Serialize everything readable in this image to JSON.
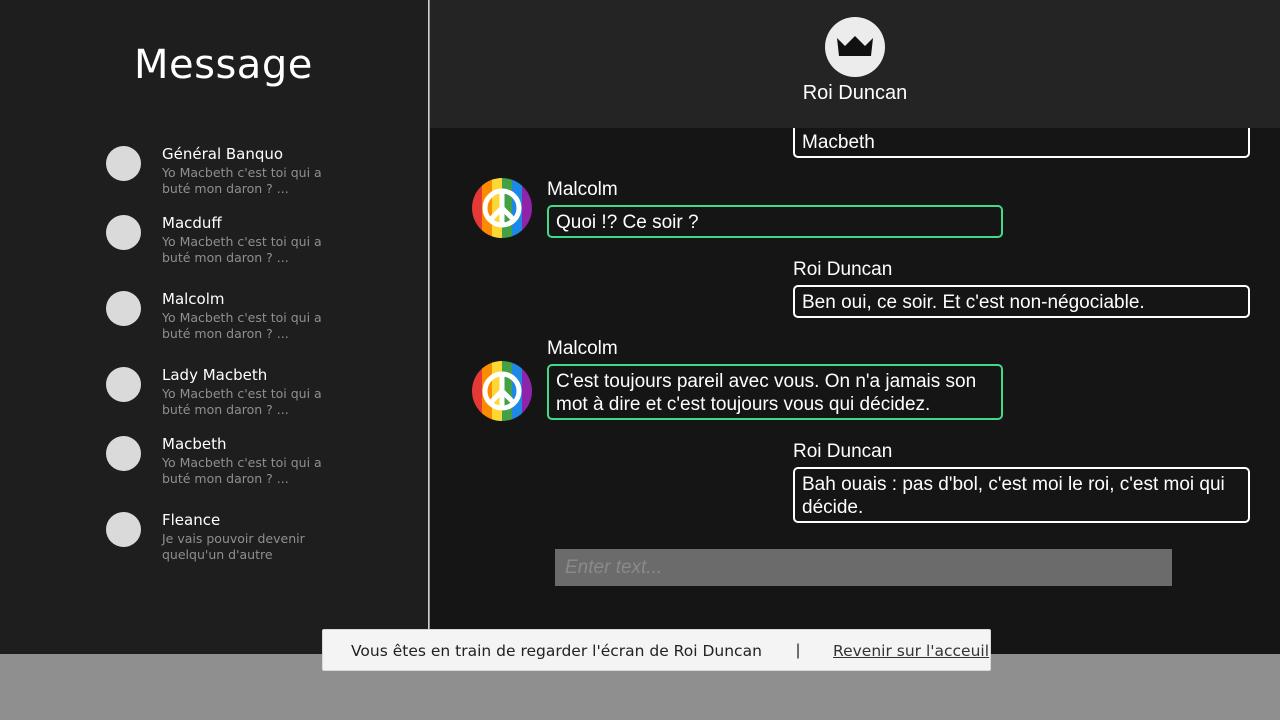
{
  "sidebar": {
    "title": "Message",
    "contacts": [
      {
        "name": "Général Banquo",
        "preview": "Yo Macbeth c'est toi qui a buté mon daron ? ..."
      },
      {
        "name": "Macduff",
        "preview": "Yo Macbeth c'est toi qui a buté mon daron ? ..."
      },
      {
        "name": "Malcolm",
        "preview": "Yo Macbeth c'est toi qui a buté mon daron ? ..."
      },
      {
        "name": "Lady Macbeth",
        "preview": "Yo Macbeth c'est toi qui a buté mon daron ? ..."
      },
      {
        "name": "Macbeth",
        "preview": "Yo Macbeth c'est toi qui a buté mon daron ? ..."
      },
      {
        "name": "Fleance",
        "preview": "Je vais pouvoir devenir quelqu'un d'autre"
      }
    ]
  },
  "header": {
    "name": "Roi Duncan",
    "avatar_icon": "crown-icon"
  },
  "chat": {
    "messages": [
      {
        "sender": "",
        "text": "Macbeth",
        "direction": "out"
      },
      {
        "sender": "Malcolm",
        "text": "Quoi !? Ce soir ?",
        "direction": "in",
        "avatar_icon": "peace-rainbow-icon"
      },
      {
        "sender": "Roi Duncan",
        "text": "Ben oui, ce soir. Et c'est non-négociable.",
        "direction": "out"
      },
      {
        "sender": "Malcolm",
        "text": "C'est toujours pareil avec vous. On n'a jamais son mot à dire et c'est toujours vous qui décidez.",
        "direction": "in",
        "avatar_icon": "peace-rainbow-icon"
      },
      {
        "sender": "Roi Duncan",
        "text": "Bah ouais : pas d'bol, c'est moi le roi, c'est moi qui décide.",
        "direction": "out"
      }
    ],
    "input_placeholder": "Enter text..."
  },
  "banner": {
    "text": "Vous êtes en train de regarder l'écran de Roi Duncan",
    "separator": "|",
    "link": "Revenir sur l'acceuil"
  },
  "colors": {
    "incoming_border": "#44d98a",
    "outgoing_border": "#ffffff",
    "sidebar_bg": "#1e1e1e",
    "chat_bg": "#151515",
    "header_bg": "#242424"
  }
}
